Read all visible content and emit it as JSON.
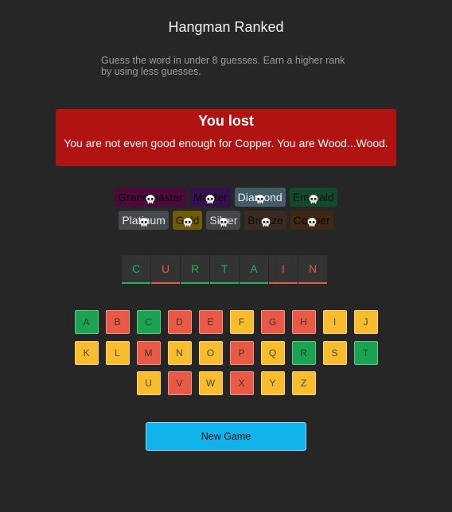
{
  "header": {
    "title": "Hangman Ranked"
  },
  "intro": {
    "text": "Guess the word in under 8 guesses. Earn a higher rank by using less guesses."
  },
  "result": {
    "heading": "You lost",
    "message": "You are not even good enough for Copper. You are Wood...Wood."
  },
  "ranks": [
    {
      "label": "Grandmaster",
      "bg": "#4b0a3a",
      "fg": "#11060e"
    },
    {
      "label": "Master",
      "bg": "#35104a",
      "fg": "#120619"
    },
    {
      "label": "Diamond",
      "bg": "#435c66",
      "fg": "#e3eef2"
    },
    {
      "label": "Emerald",
      "bg": "#14492b",
      "fg": "#0a1a10"
    },
    {
      "label": "Platinum",
      "bg": "#444a4c",
      "fg": "#e6e9ea"
    },
    {
      "label": "Gold",
      "bg": "#6f5a08",
      "fg": "#1c1702"
    },
    {
      "label": "Silver",
      "bg": "#444648",
      "fg": "#dcdcdc"
    },
    {
      "label": "Bronze",
      "bg": "#3a2a1f",
      "fg": "#0e0a07"
    },
    {
      "label": "Copper",
      "bg": "#402615",
      "fg": "#0f0905"
    }
  ],
  "word": {
    "letters": [
      {
        "char": "C",
        "state": "hit"
      },
      {
        "char": "U",
        "state": "miss"
      },
      {
        "char": "R",
        "state": "hit"
      },
      {
        "char": "T",
        "state": "hit"
      },
      {
        "char": "A",
        "state": "hit"
      },
      {
        "char": "I",
        "state": "miss"
      },
      {
        "char": "N",
        "state": "miss"
      }
    ],
    "colors": {
      "hit": "#20b25c",
      "miss": "#e35a45"
    }
  },
  "keyboard": {
    "rows": [
      [
        [
          "A",
          "green"
        ],
        [
          "B",
          "red"
        ],
        [
          "C",
          "green"
        ],
        [
          "D",
          "red"
        ],
        [
          "E",
          "red"
        ],
        [
          "F",
          "yellow"
        ],
        [
          "G",
          "red"
        ],
        [
          "H",
          "red"
        ],
        [
          "I",
          "yellow"
        ],
        [
          "J",
          "yellow"
        ]
      ],
      [
        [
          "K",
          "yellow"
        ],
        [
          "L",
          "yellow"
        ],
        [
          "M",
          "red"
        ],
        [
          "N",
          "yellow"
        ],
        [
          "O",
          "yellow"
        ],
        [
          "P",
          "red"
        ],
        [
          "Q",
          "yellow"
        ],
        [
          "R",
          "green"
        ],
        [
          "S",
          "yellow"
        ],
        [
          "T",
          "green"
        ]
      ],
      [
        [
          "U",
          "yellow"
        ],
        [
          "V",
          "red"
        ],
        [
          "W",
          "yellow"
        ],
        [
          "X",
          "red"
        ],
        [
          "Y",
          "yellow"
        ],
        [
          "Z",
          "yellow"
        ]
      ]
    ]
  },
  "actions": {
    "new_game_label": "New Game"
  }
}
